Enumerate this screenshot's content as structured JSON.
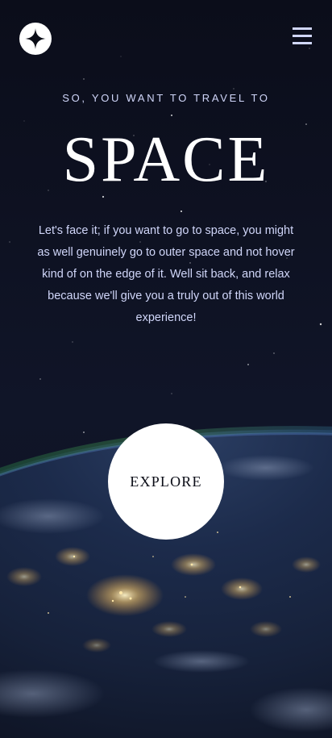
{
  "colors": {
    "background": "#0b0d17",
    "accent_light": "#d0d6f9",
    "white": "#ffffff"
  },
  "header": {
    "logo_icon": "star-logo-icon",
    "menu_icon": "hamburger-menu-icon"
  },
  "hero": {
    "eyebrow": "SO, YOU WANT TO TRAVEL TO",
    "title": "SPACE",
    "body": "Let's face it; if you want to go to space, you might as well genuinely go to outer space and not hover kind of on the edge of it. Well sit back, and relax because we'll give you a truly out of this world experience!"
  },
  "cta": {
    "explore_label": "EXPLORE"
  }
}
